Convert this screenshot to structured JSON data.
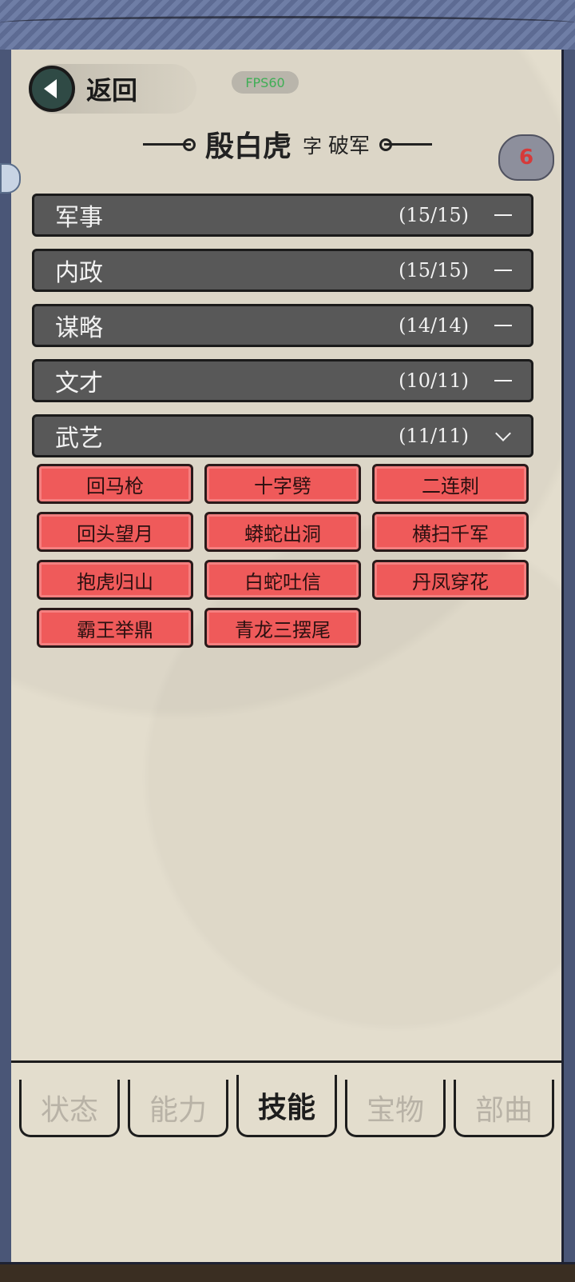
{
  "header": {
    "back_label": "返回",
    "fps_label": "FPS60",
    "title_name": "殷白虎",
    "title_zi_label": "字",
    "title_style_name": "破军",
    "badge_value": "6"
  },
  "categories": [
    {
      "name": "军事",
      "count": "(15/15)",
      "state": "collapsed"
    },
    {
      "name": "内政",
      "count": "(15/15)",
      "state": "collapsed"
    },
    {
      "name": "谋略",
      "count": "(14/14)",
      "state": "collapsed"
    },
    {
      "name": "文才",
      "count": "(10/11)",
      "state": "collapsed"
    },
    {
      "name": "武艺",
      "count": "(11/11)",
      "state": "expanded"
    }
  ],
  "skills": [
    "回马枪",
    "十字劈",
    "二连刺",
    "回头望月",
    "蟒蛇出洞",
    "横扫千军",
    "抱虎归山",
    "白蛇吐信",
    "丹凤穿花",
    "霸王举鼎",
    "青龙三摆尾"
  ],
  "tabs": [
    {
      "label": "状态",
      "active": false
    },
    {
      "label": "能力",
      "active": false
    },
    {
      "label": "技能",
      "active": true
    },
    {
      "label": "宝物",
      "active": false
    },
    {
      "label": "部曲",
      "active": false
    }
  ],
  "colors": {
    "skill_red": "#ef5a5a",
    "category_gray": "#585858",
    "paper": "#e3ddcd",
    "frame_blue": "#4a5677",
    "fps_green": "#3fae55"
  }
}
